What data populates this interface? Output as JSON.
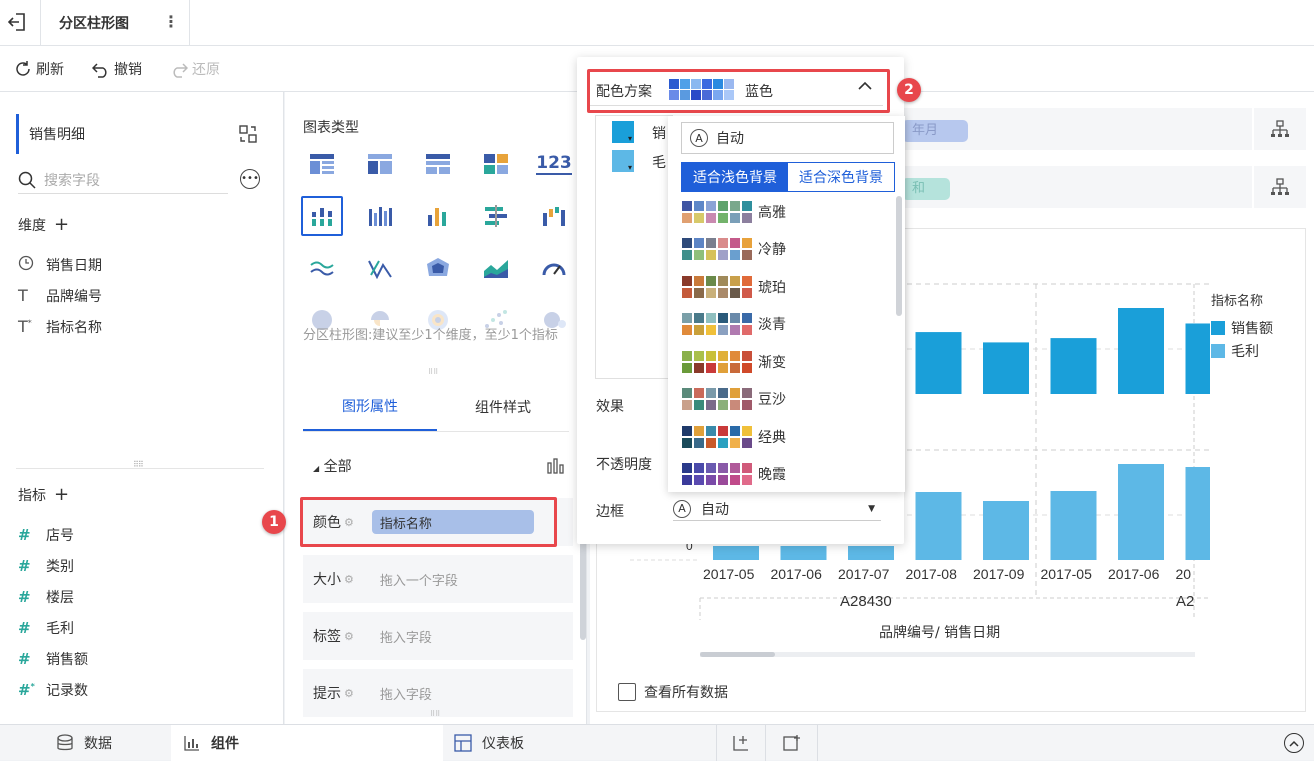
{
  "header": {
    "title": "分区柱形图"
  },
  "toolbar": {
    "refresh": "刷新",
    "undo": "撤销",
    "redo": "还原"
  },
  "left": {
    "dataset": "销售明细",
    "search_placeholder": "搜索字段",
    "dim_title": "维度",
    "dimensions": [
      "销售日期",
      "品牌编号",
      "指标名称"
    ],
    "measure_title": "指标",
    "measures": [
      "店号",
      "类别",
      "楼层",
      "毛利",
      "销售额",
      "记录数"
    ]
  },
  "mid": {
    "chart_type_title": "图表类型",
    "hint": "分区柱形图:建议至少1个维度，至少1个指标",
    "tabs": [
      "图形属性",
      "组件样式"
    ],
    "all": "全部",
    "props": [
      {
        "label": "颜色",
        "value": "指标名称"
      },
      {
        "label": "大小",
        "value": "拖入一个字段"
      },
      {
        "label": "标签",
        "value": "拖入字段"
      },
      {
        "label": "提示",
        "value": "拖入字段"
      }
    ]
  },
  "popup": {
    "scheme_label": "配色方案",
    "scheme_value": "蓝色",
    "legend_items": [
      "销",
      "毛"
    ],
    "effect": "效果",
    "opacity": "不透明度",
    "border": "边框",
    "border_value": "自动"
  },
  "dropdown": {
    "auto": "自动",
    "tabs": [
      "适合浅色背景",
      "适合深色背景"
    ],
    "palettes": [
      {
        "name": "高雅",
        "colors": [
          "#3f55a3",
          "#5e87c8",
          "#8aa3d6",
          "#5fa36d",
          "#7aa88c",
          "#2f8f9d",
          "#e0a071",
          "#d7c96a",
          "#c98ab0",
          "#73b36b",
          "#7a9fb8",
          "#8c7f9e"
        ]
      },
      {
        "name": "冷静",
        "colors": [
          "#2e4a7a",
          "#5c84c4",
          "#7a7f8f",
          "#d98b8b",
          "#c45a8a",
          "#e8a23b",
          "#3f8f8a",
          "#8fbf7a",
          "#d6c15a",
          "#a0a0c8",
          "#6a9fcf",
          "#9a6a5a"
        ]
      },
      {
        "name": "琥珀",
        "colors": [
          "#8a3a2a",
          "#c97a3a",
          "#6a8a4a",
          "#a08a5a",
          "#c9a04a",
          "#e06a3a",
          "#c45a3a",
          "#8a6a4a",
          "#c9b07a",
          "#aa8a6a",
          "#6a5a4a",
          "#d05a4a"
        ]
      },
      {
        "name": "淡青",
        "colors": [
          "#7a9fa8",
          "#4a7a8a",
          "#8fbfbf",
          "#2a5a7a",
          "#6a8aaa",
          "#3a6aa8",
          "#e08a3a",
          "#c9a03a",
          "#f0c03a",
          "#8aa0c0",
          "#b07ab0",
          "#e06a6a"
        ]
      },
      {
        "name": "渐变",
        "colors": [
          "#8ab04a",
          "#aac04a",
          "#c9c03a",
          "#e0b03a",
          "#e08a3a",
          "#c9503a",
          "#6a9a3a",
          "#8a3a2a",
          "#c93a3a",
          "#e0a03a",
          "#c96a3a",
          "#d04a2a"
        ]
      },
      {
        "name": "豆沙",
        "colors": [
          "#5a8a7a",
          "#c96a5a",
          "#7a9aaa",
          "#4a6a8a",
          "#e0a03a",
          "#8a6a7a",
          "#c9a08a",
          "#3a8a7a",
          "#7a6a8a",
          "#8ab07a",
          "#c98a7a",
          "#a05a6a"
        ]
      },
      {
        "name": "经典",
        "colors": [
          "#1f3a6a",
          "#e0a03a",
          "#3a8aaa",
          "#c93a3a",
          "#2a6aa8",
          "#f0c03a",
          "#1a4a5a",
          "#3a6a8a",
          "#c95a2a",
          "#2aa0c0",
          "#f0b04a",
          "#6a4a8a"
        ]
      },
      {
        "name": "晚霞",
        "colors": [
          "#2a3a8a",
          "#4a4aaa",
          "#6a5ab0",
          "#8a5aa8",
          "#b05a9a",
          "#d05a7a",
          "#3a3a9a",
          "#5a4ab0",
          "#7a4aa8",
          "#9a4a9a",
          "#c04a8a",
          "#e06a8a"
        ]
      }
    ]
  },
  "chart_panel": {
    "pill1": "年月",
    "pill2": "和",
    "legend_title": "指标名称",
    "x_axis_title": "品牌编号/ 销售日期",
    "zero": "0",
    "show_all": "查看所有数据"
  },
  "chart_data": {
    "type": "bar",
    "categories": [
      "2017-05",
      "2017-06",
      "2017-07",
      "2017-08",
      "2017-09",
      "2017-05",
      "2017-06",
      "20"
    ],
    "group_labels": [
      "A28430",
      "A2"
    ],
    "series": [
      {
        "name": "销售额",
        "values": [
          null,
          null,
          null,
          0.72,
          0.6,
          0.65,
          1.0,
          0.82
        ]
      },
      {
        "name": "毛利",
        "values": [
          0.14,
          0.14,
          0.14,
          0.68,
          0.59,
          0.69,
          0.96,
          0.93
        ]
      }
    ],
    "colors": {
      "销售额": "#1a9fd9",
      "毛利": "#5db8e6"
    }
  },
  "bottom": {
    "tabs": [
      "数据",
      "组件",
      "仪表板"
    ]
  }
}
